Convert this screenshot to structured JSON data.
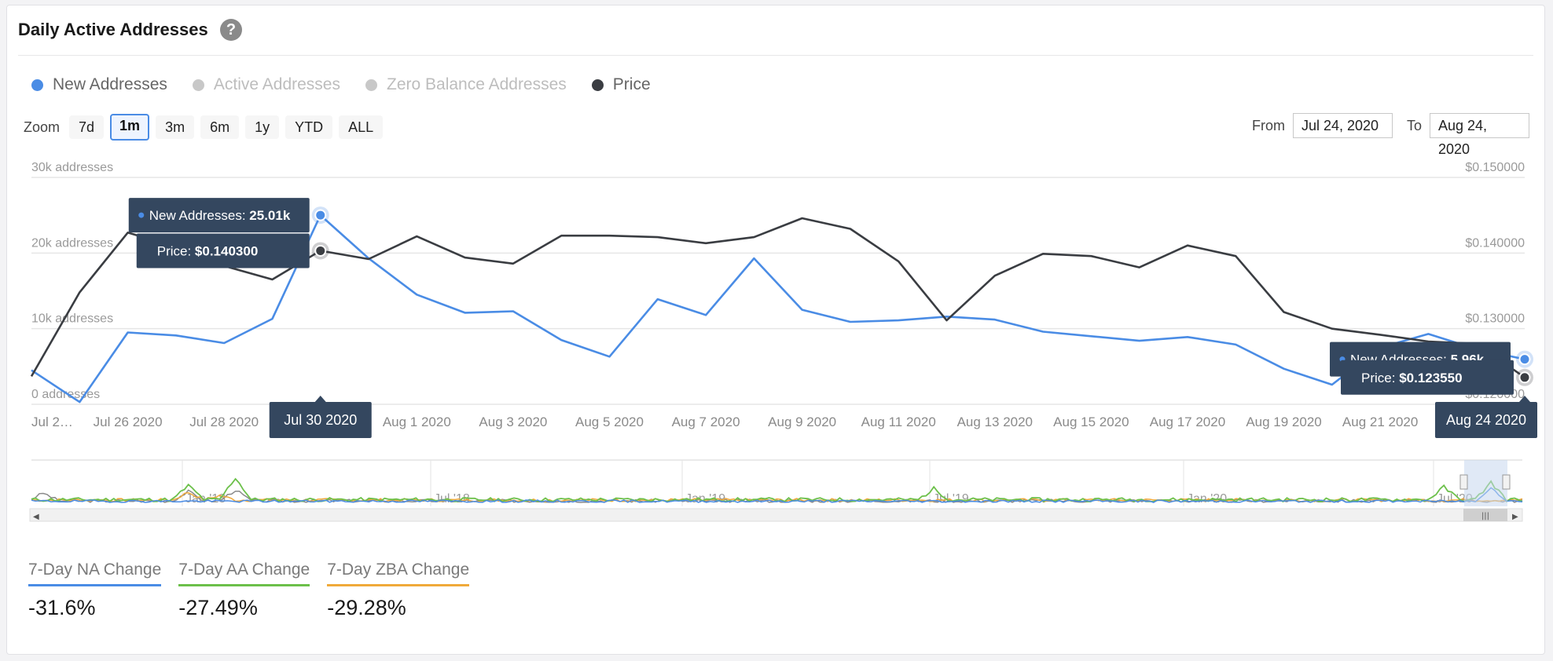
{
  "title": "Daily Active Addresses",
  "help_glyph": "?",
  "legend": [
    {
      "label": "New Addresses",
      "color": "#4a8ce5",
      "active": true
    },
    {
      "label": "Active Addresses",
      "color": "#c8c8c8",
      "active": false
    },
    {
      "label": "Zero Balance Addresses",
      "color": "#c8c8c8",
      "active": false
    },
    {
      "label": "Price",
      "color": "#3a3d42",
      "active": true
    }
  ],
  "zoom": {
    "label": "Zoom",
    "buttons": [
      "7d",
      "1m",
      "3m",
      "6m",
      "1y",
      "YTD",
      "ALL"
    ],
    "active": "1m"
  },
  "range": {
    "from_label": "From",
    "from": "Jul 24, 2020",
    "to_label": "To",
    "to": "Aug 24, 2020"
  },
  "chart_data": {
    "type": "line",
    "x": [
      "Jul 24",
      "Jul 25",
      "Jul 26",
      "Jul 27",
      "Jul 28",
      "Jul 29",
      "Jul 30",
      "Jul 31",
      "Aug 1",
      "Aug 2",
      "Aug 3",
      "Aug 4",
      "Aug 5",
      "Aug 6",
      "Aug 7",
      "Aug 8",
      "Aug 9",
      "Aug 10",
      "Aug 11",
      "Aug 12",
      "Aug 13",
      "Aug 14",
      "Aug 15",
      "Aug 16",
      "Aug 17",
      "Aug 18",
      "Aug 19",
      "Aug 20",
      "Aug 21",
      "Aug 22",
      "Aug 23",
      "Aug 24"
    ],
    "series": [
      {
        "name": "New Addresses",
        "axis": "left",
        "color": "#4a8ce5",
        "values": [
          4500,
          300,
          9500,
          9100,
          8100,
          11300,
          25010,
          19300,
          14500,
          12100,
          12300,
          8500,
          6300,
          13900,
          11800,
          19300,
          12500,
          10900,
          11100,
          11600,
          11200,
          9600,
          9000,
          8400,
          8900,
          7900,
          4700,
          2600,
          7500,
          9300,
          7300,
          5960
        ]
      },
      {
        "name": "Price",
        "axis": "right",
        "color": "#3a3d42",
        "values": [
          0.1237,
          0.1348,
          0.1427,
          0.1408,
          0.1383,
          0.1365,
          0.1403,
          0.1392,
          0.1422,
          0.1394,
          0.1386,
          0.1423,
          0.1423,
          0.1421,
          0.1413,
          0.1421,
          0.1446,
          0.1432,
          0.1389,
          0.1311,
          0.137,
          0.1399,
          0.1396,
          0.1381,
          0.141,
          0.1396,
          0.1322,
          0.13,
          0.1292,
          0.1283,
          0.128,
          0.12355
        ]
      }
    ],
    "x_tick_labels": [
      {
        "label": "Jul 2…",
        "x": "Jul 24"
      },
      {
        "label": "Jul 26 2020",
        "x": "Jul 26"
      },
      {
        "label": "Jul 28 2020",
        "x": "Jul 28"
      },
      {
        "label": "Aug 1 2020",
        "x": "Aug 1"
      },
      {
        "label": "Aug 3 2020",
        "x": "Aug 3"
      },
      {
        "label": "Aug 5 2020",
        "x": "Aug 5"
      },
      {
        "label": "Aug 7 2020",
        "x": "Aug 7"
      },
      {
        "label": "Aug 9 2020",
        "x": "Aug 9"
      },
      {
        "label": "Aug 11 2020",
        "x": "Aug 11"
      },
      {
        "label": "Aug 13 2020",
        "x": "Aug 13"
      },
      {
        "label": "Aug 15 2020",
        "x": "Aug 15"
      },
      {
        "label": "Aug 17 2020",
        "x": "Aug 17"
      },
      {
        "label": "Aug 19 2020",
        "x": "Aug 19"
      },
      {
        "label": "Aug 21 2020",
        "x": "Aug 21"
      }
    ],
    "y_left": {
      "ticks": [
        0,
        10000,
        20000,
        30000
      ],
      "labels": [
        "0 addresses",
        "10k addresses",
        "20k addresses",
        "30k addresses"
      ],
      "ylim": [
        0,
        30000
      ]
    },
    "y_right": {
      "ticks": [
        0.12,
        0.13,
        0.14,
        0.15
      ],
      "labels": [
        "$0.120000",
        "$0.130000",
        "$0.140000",
        "$0.150000"
      ],
      "ylim": [
        0.12,
        0.15
      ]
    },
    "grid": true,
    "tooltips": [
      {
        "x": "Jul 30",
        "date_label": "Jul 30 2020",
        "na_label": "New Addresses:",
        "na_value": "25.01k",
        "price_label": "Price:",
        "price_value": "$0.140300"
      },
      {
        "x": "Aug 24",
        "date_label": "Aug 24 2020",
        "na_label": "New Addresses:",
        "na_value": "5.96k",
        "price_label": "Price:",
        "price_value": "$0.123550"
      }
    ],
    "navigator": {
      "labels": [
        "Jan '18",
        "Jul '18",
        "Jan '19",
        "Jul '19",
        "Jan '20",
        "Jul '20"
      ],
      "colors": {
        "active": "#6cc04a",
        "zero_balance": "#f0a93a",
        "new": "#4a8ce5",
        "price": "#8a8a8a"
      }
    }
  },
  "stats": [
    {
      "label": "7-Day NA Change",
      "value": "-31.6%",
      "color": "#4a8ce5"
    },
    {
      "label": "7-Day AA Change",
      "value": "-27.49%",
      "color": "#6cc04a"
    },
    {
      "label": "7-Day ZBA Change",
      "value": "-29.28%",
      "color": "#f0a93a"
    }
  ]
}
